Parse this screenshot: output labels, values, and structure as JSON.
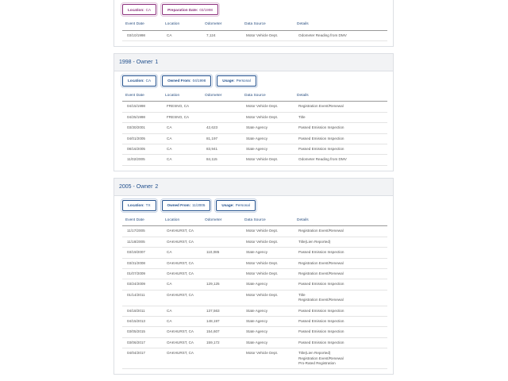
{
  "section0": {
    "chips": [
      {
        "label": "Location:",
        "value": "CA",
        "style": "purple"
      },
      {
        "label": "Preparation Date:",
        "value": "03/1998",
        "style": "purple"
      }
    ],
    "columns": [
      "Event Date",
      "Location",
      "Odometer",
      "Data Source",
      "Details"
    ],
    "rows": [
      {
        "date": "03/10/1998",
        "location": "CA",
        "odometer": "7,124",
        "source": "Motor Vehicle Dept.",
        "details": [
          "Odometer Reading from DMV"
        ]
      }
    ]
  },
  "section1": {
    "year": "1998 - Owner",
    "owner": "1",
    "chips": [
      {
        "label": "Location:",
        "value": "CA"
      },
      {
        "label": "Owned From:",
        "value": "04/1998"
      },
      {
        "label": "Usage:",
        "value": "Personal"
      }
    ],
    "columns": [
      "Event Date",
      "Location",
      "Odometer",
      "Data Source",
      "Details"
    ],
    "rows": [
      {
        "date": "04/15/1998",
        "location": "FRESNO, CA",
        "odometer": "",
        "source": "Motor Vehicle Dept.",
        "details": [
          "Registration Event/Renewal"
        ]
      },
      {
        "date": "04/25/1998",
        "location": "FRESNO, CA",
        "odometer": "",
        "source": "Motor Vehicle Dept.",
        "details": [
          "Title"
        ]
      },
      {
        "date": "03/30/2001",
        "location": "CA",
        "odometer": "42,623",
        "source": "State Agency",
        "details": [
          "Passed Emission Inspection"
        ]
      },
      {
        "date": "04/01/2005",
        "location": "CA",
        "odometer": "81,197",
        "source": "State Agency",
        "details": [
          "Passed Emission Inspection"
        ]
      },
      {
        "date": "08/16/2005",
        "location": "CA",
        "odometer": "83,941",
        "source": "State Agency",
        "details": [
          "Passed Emission Inspection"
        ]
      },
      {
        "date": "11/02/2005",
        "location": "CA",
        "odometer": "84,115",
        "source": "Motor Vehicle Dept.",
        "details": [
          "Odometer Reading from DMV"
        ]
      }
    ]
  },
  "section2": {
    "year": "2005 - Owner",
    "owner": "2",
    "chips": [
      {
        "label": "Location:",
        "value": "TX"
      },
      {
        "label": "Owned From:",
        "value": "11/2005"
      },
      {
        "label": "Usage:",
        "value": "Personal"
      }
    ],
    "columns": [
      "Event Date",
      "Location",
      "Odometer",
      "Data Source",
      "Details"
    ],
    "rows": [
      {
        "date": "11/17/2005",
        "location": "OAKHURST, CA",
        "odometer": "",
        "source": "Motor Vehicle Dept.",
        "details": [
          "Registration Event/Renewal"
        ]
      },
      {
        "date": "11/18/2005",
        "location": "OAKHURST, CA",
        "odometer": "",
        "source": "Motor Vehicle Dept.",
        "details": [
          "Title(Lien Reported)"
        ]
      },
      {
        "date": "03/19/2007",
        "location": "CA",
        "odometer": "110,085",
        "source": "State Agency",
        "details": [
          "Passed Emission Inspection"
        ]
      },
      {
        "date": "03/31/2008",
        "location": "OAKHURST, CA",
        "odometer": "",
        "source": "Motor Vehicle Dept.",
        "details": [
          "Registration Event/Renewal"
        ]
      },
      {
        "date": "01/07/2009",
        "location": "OAKHURST, CA",
        "odometer": "",
        "source": "Motor Vehicle Dept.",
        "details": [
          "Registration Event/Renewal"
        ]
      },
      {
        "date": "03/24/2009",
        "location": "CA",
        "odometer": "129,125",
        "source": "State Agency",
        "details": [
          "Passed Emission Inspection"
        ]
      },
      {
        "date": "01/14/2011",
        "location": "OAKHURST, CA",
        "odometer": "",
        "source": "Motor Vehicle Dept.",
        "details": [
          "Title",
          "Registration Event/Renewal"
        ]
      },
      {
        "date": "04/18/2011",
        "location": "CA",
        "odometer": "137,563",
        "source": "State Agency",
        "details": [
          "Passed Emission Inspection"
        ]
      },
      {
        "date": "04/15/2013",
        "location": "CA",
        "odometer": "148,197",
        "source": "State Agency",
        "details": [
          "Passed Emission Inspection"
        ]
      },
      {
        "date": "03/05/2015",
        "location": "OAKHURST, CA",
        "odometer": "154,607",
        "source": "State Agency",
        "details": [
          "Passed Emission Inspection"
        ]
      },
      {
        "date": "03/06/2017",
        "location": "OAKHURST, CA",
        "odometer": "159,172",
        "source": "State Agency",
        "details": [
          "Passed Emission Inspection"
        ]
      },
      {
        "date": "04/04/2017",
        "location": "OAKHURST, CA",
        "odometer": "",
        "source": "Motor Vehicle Dept.",
        "details": [
          "Title(Lien Reported)",
          "Registration Event/Renewal",
          "Pro-Rated Registration"
        ]
      }
    ]
  }
}
